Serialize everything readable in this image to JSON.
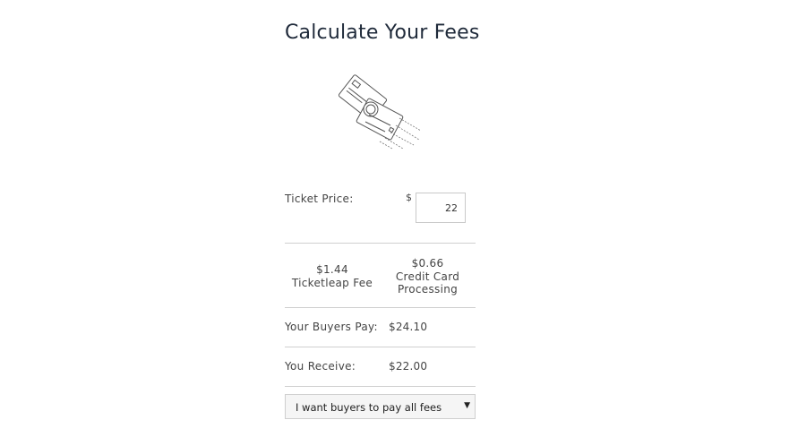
{
  "calculator": {
    "title": "Calculate Your Fees",
    "illustration_icon": "credit-cards-flying-icon",
    "ticket_price": {
      "label": "Ticket Price:",
      "currency_symbol": "$",
      "value": "22"
    },
    "fees": [
      {
        "amount": "$1.44",
        "name": "Ticketleap Fee"
      },
      {
        "amount": "$0.66",
        "name": "Credit Card Processing"
      }
    ],
    "buyers_pay": {
      "label": "Your Buyers Pay:",
      "amount": "$24.10"
    },
    "you_receive": {
      "label": "You Receive:",
      "amount": "$22.00"
    },
    "fee_option": {
      "selected": "I want buyers to pay all fees",
      "arrow_icon": "triangle-down-icon"
    }
  },
  "colors": {
    "title": "#1f2a3a",
    "text": "#444444",
    "divider": "#cfcfcf",
    "select_bg": "#f5f5f5"
  }
}
